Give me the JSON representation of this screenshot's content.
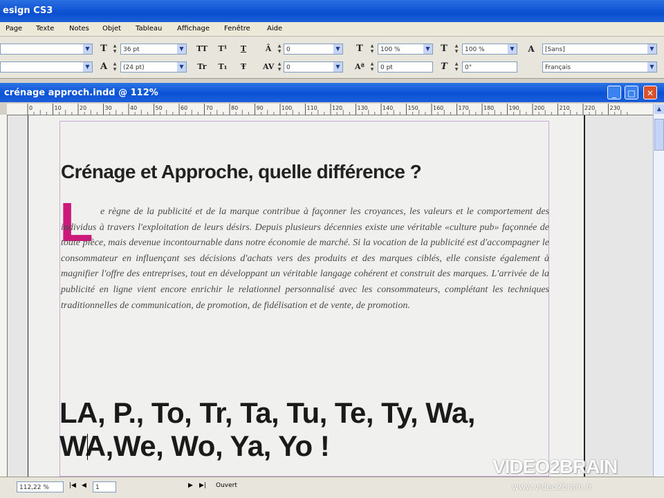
{
  "app": {
    "title": "esign CS3"
  },
  "menu": [
    "Page",
    "Texte",
    "Notes",
    "Objet",
    "Tableau",
    "Affichage",
    "Fenêtre",
    "Aide"
  ],
  "control_panel": {
    "font_family": "",
    "font_style": "",
    "font_size": "36 pt",
    "leading": "(24 pt)",
    "kerning": "0",
    "tracking": "0",
    "vertical_scale": "100 %",
    "baseline_shift": "0 pt",
    "horizontal_scale": "100 %",
    "skew": "0°",
    "char_style": "[Sans]",
    "language": "Français",
    "labels": {
      "allcaps": "TT",
      "superscript": "T¹",
      "underline": "T",
      "smallcaps": "Tr",
      "subscript": "T₁",
      "strike": "Ŧ"
    }
  },
  "document": {
    "title": "crénage approch.indd @ 112%",
    "ruler_ticks": [
      "0",
      "10",
      "20",
      "30",
      "40",
      "50",
      "60",
      "70",
      "80",
      "90",
      "100",
      "110",
      "120",
      "130",
      "140",
      "150",
      "160",
      "170",
      "180",
      "190",
      "200",
      "210",
      "220",
      "230"
    ],
    "heading": "Crénage et Approche, quelle différence ?",
    "drop_cap": "L",
    "paragraph": "e règne de la publicité et de la marque contribue à façonner les croyances, les valeurs et le comportement des individus à travers l'exploitation de leurs désirs. Depuis plusieurs décennies existe une véritable «culture pub» façonnée de toute pièce, mais devenue incontournable dans notre économie de marché. Si la vocation de la publicité est d'accompagner le consommateur en influençant ses décisions d'achats vers des produits et des marques ciblés, elle consiste également à magnifier l'offre des entreprises, tout en développant un véritable langage cohérent et construit des marques. L'arrivée de la publicité en ligne vient encore enrichir le relationnel personnalisé avec les consommateurs, complétant les techniques traditionnelles de communication, de promotion, de fidélisation et de vente, de promotion.",
    "kerning_line1": "LA, P., To, Tr, Ta, Tu, Te, Ty, Wa,",
    "kerning_line2": "WA,We, Wo, Ya, Yo !"
  },
  "status": {
    "zoom": "112,22 %",
    "page": "1",
    "state": "Ouvert"
  },
  "watermark": {
    "logo": "VIDEO2BRAIN",
    "url": "www.video2brain.fr"
  },
  "colors": {
    "title_bar": "#0a4fd0",
    "drop_cap": "#cc1a7a",
    "margin_guide": "#c9a9d6"
  }
}
